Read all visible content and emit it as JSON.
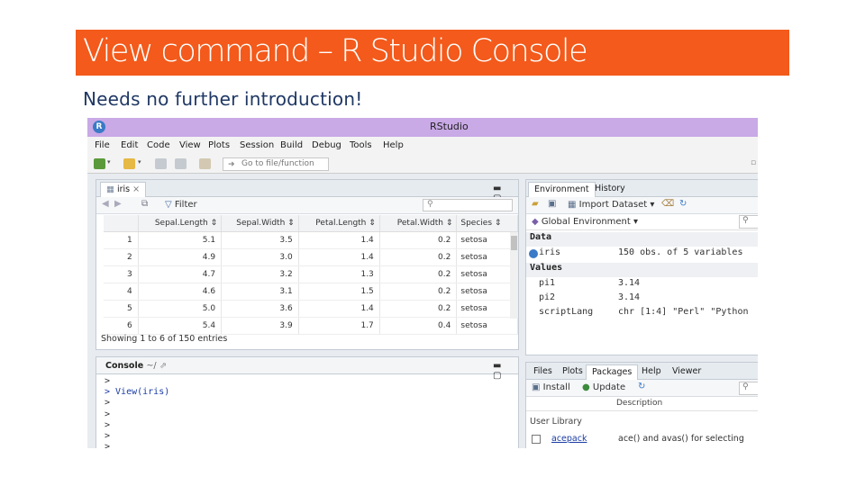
{
  "slide": {
    "title": "View command – R Studio Console",
    "subtitle": "Needs no further introduction!"
  },
  "colors": {
    "title_bg": "#F35A1B",
    "titlebar": "#C9A9E6",
    "subtitle": "#1F3864"
  },
  "rstudio": {
    "app_title": "RStudio",
    "menu": [
      "File",
      "Edit",
      "Code",
      "View",
      "Plots",
      "Session",
      "Build",
      "Debug",
      "Tools",
      "Help"
    ],
    "goto_placeholder": "Go to file/function",
    "source_pane": {
      "tab": "iris",
      "filter_label": "Filter",
      "columns": [
        "Sepal.Length",
        "Sepal.Width",
        "Petal.Length",
        "Petal.Width",
        "Species"
      ],
      "rows": [
        [
          "1",
          "5.1",
          "3.5",
          "1.4",
          "0.2",
          "setosa"
        ],
        [
          "2",
          "4.9",
          "3.0",
          "1.4",
          "0.2",
          "setosa"
        ],
        [
          "3",
          "4.7",
          "3.2",
          "1.3",
          "0.2",
          "setosa"
        ],
        [
          "4",
          "4.6",
          "3.1",
          "1.5",
          "0.2",
          "setosa"
        ],
        [
          "5",
          "5.0",
          "3.6",
          "1.4",
          "0.2",
          "setosa"
        ],
        [
          "6",
          "5.4",
          "3.9",
          "1.7",
          "0.4",
          "setosa"
        ]
      ],
      "footer": "Showing 1 to 6 of 150 entries"
    },
    "console_pane": {
      "tab": "Console",
      "path": "~/",
      "lines": [
        ">",
        "> View(iris)",
        ">",
        ">",
        ">",
        ">",
        ">"
      ]
    },
    "env_pane": {
      "tabs": [
        "Environment",
        "History"
      ],
      "import_label": "Import Dataset",
      "scope_label": "Global Environment",
      "data_header": "Data",
      "data_rows": [
        {
          "name": "iris",
          "value": "150 obs. of 5 variables"
        }
      ],
      "values_header": "Values",
      "value_rows": [
        {
          "name": "pi1",
          "value": "3.14"
        },
        {
          "name": "pi2",
          "value": "3.14"
        },
        {
          "name": "scriptLang",
          "value": "chr [1:4] \"Perl\" \"Python"
        }
      ]
    },
    "files_pane": {
      "tabs": [
        "Files",
        "Plots",
        "Packages",
        "Help",
        "Viewer"
      ],
      "install_label": "Install",
      "update_label": "Update",
      "col_description": "Description",
      "user_library": "User Library",
      "packages": [
        {
          "name": "acepack",
          "desc": "ace() and avas() for selecting"
        }
      ]
    }
  }
}
